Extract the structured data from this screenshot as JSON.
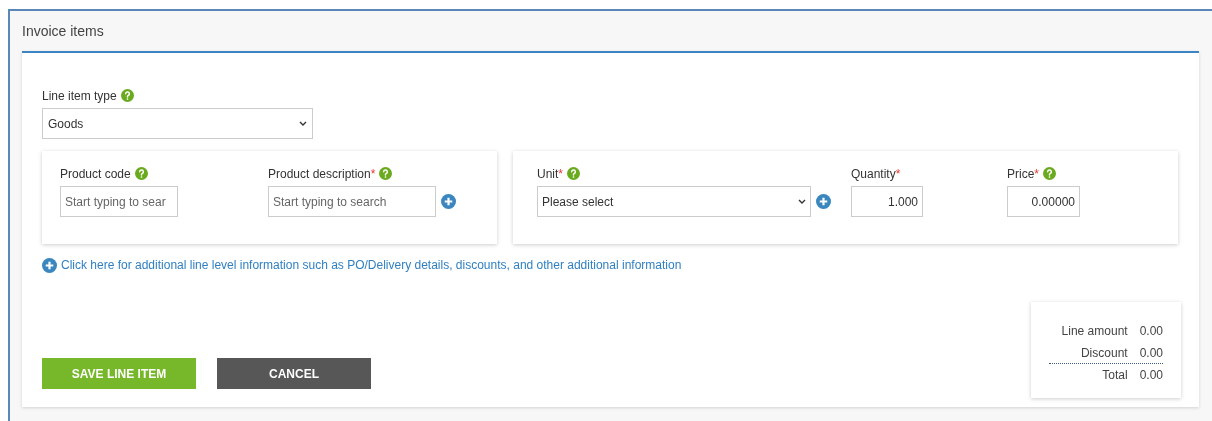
{
  "section": {
    "title": "Invoice items"
  },
  "line_item_type": {
    "label": "Line item type",
    "help": true,
    "value": "Goods"
  },
  "field_groups": [
    {
      "fields": [
        {
          "kind": "search",
          "label": "Product code",
          "help": true,
          "placeholder": "Start typing to sear",
          "add": false
        },
        {
          "kind": "search",
          "label": "Product description",
          "required_mark": "*",
          "help": true,
          "placeholder": "Start typing to search",
          "add": true
        }
      ]
    },
    {
      "fields": [
        {
          "kind": "select",
          "label": "Unit",
          "required_mark": "*",
          "help": true,
          "value": "Please select",
          "add": true
        },
        {
          "kind": "number",
          "label": "Quantity",
          "required_mark": "*",
          "help": false,
          "value": "1.000",
          "add": false
        },
        {
          "kind": "number",
          "label": "Price",
          "required_mark": "*",
          "help": true,
          "value": "0.00000",
          "add": false
        }
      ]
    }
  ],
  "more_link": "Click here for additional line level information such as PO/Delivery details, discounts, and other additional information",
  "buttons": [
    {
      "kind": "primary",
      "label": "SAVE LINE ITEM"
    },
    {
      "kind": "secondary",
      "label": "CANCEL"
    }
  ],
  "totals": [
    {
      "label": "Line amount",
      "value": "0.00"
    },
    {
      "label": "Discount",
      "value": "0.00"
    },
    {
      "label": "Total",
      "value": "0.00"
    }
  ]
}
